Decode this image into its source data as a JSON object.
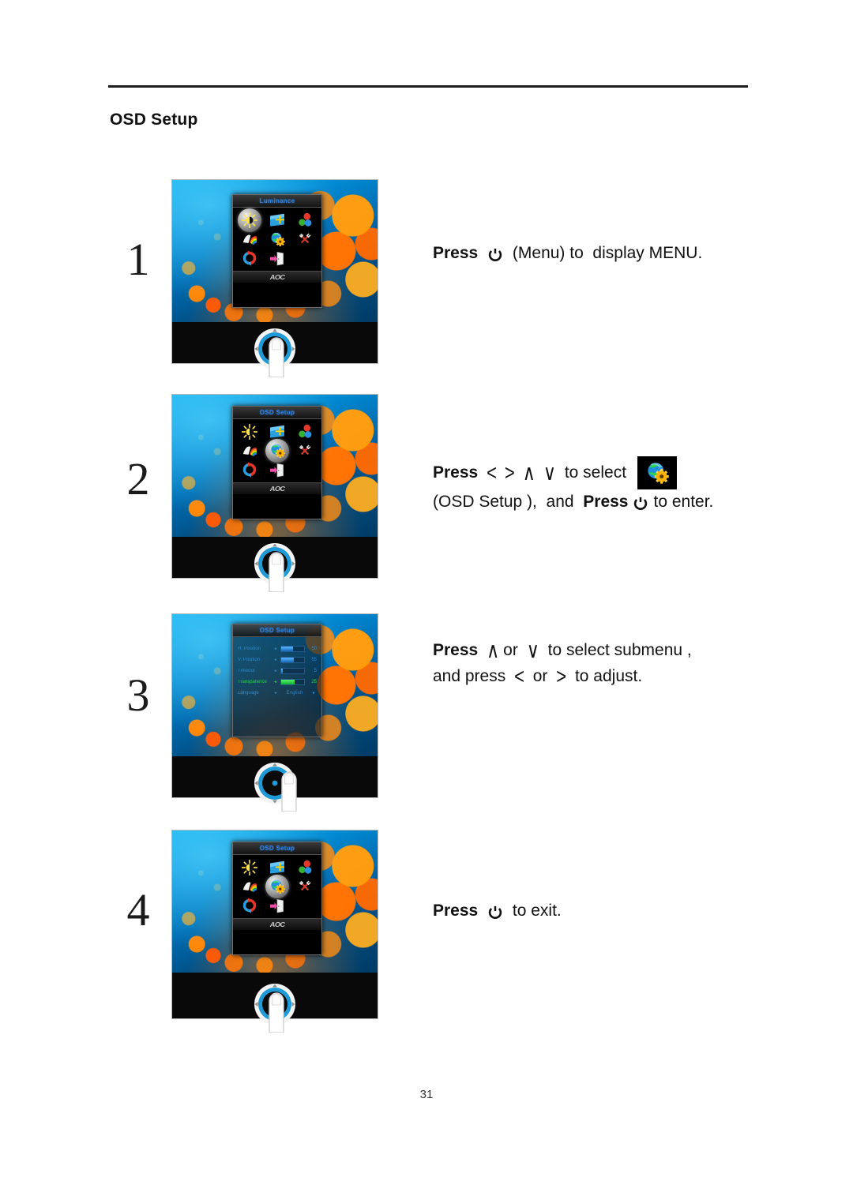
{
  "document": {
    "section_title": "OSD Setup",
    "page_number": "31"
  },
  "icons": {
    "power": "power-icon",
    "osd_setup": "osd-setup-globe-gear-icon",
    "left": "<",
    "right": ">",
    "up": "∧",
    "down": "∨"
  },
  "osd_menu": {
    "footer_logo": "AOC",
    "items": [
      "luminance-icon",
      "image-setup-icon",
      "color-temperature-icon",
      "picture-boost-icon",
      "osd-setup-icon",
      "extra-icon",
      "reset-icon",
      "exit-icon"
    ]
  },
  "steps": [
    {
      "number": "1",
      "osd_title": "Luminance",
      "selected_icon": "luminance-icon",
      "text_lines": [
        [
          {
            "t": "text",
            "v": "Press ",
            "bold": true
          },
          {
            "t": "power"
          },
          {
            "t": "text",
            "v": " (Menu) to  display MENU.",
            "bold": false
          }
        ]
      ]
    },
    {
      "number": "2",
      "osd_title": "OSD Setup",
      "selected_icon": "osd-setup-icon",
      "text_lines": [
        [
          {
            "t": "text",
            "v": "Press ",
            "bold": true
          },
          {
            "t": "chev",
            "v": "<"
          },
          {
            "t": "chev",
            "v": ">"
          },
          {
            "t": "chev",
            "v": "∧"
          },
          {
            "t": "chev",
            "v": "∨"
          },
          {
            "t": "text",
            "v": " to select ",
            "bold": false
          },
          {
            "t": "icon"
          }
        ],
        [
          {
            "t": "text",
            "v": "(OSD Setup ),  and  ",
            "bold": false
          },
          {
            "t": "text",
            "v": "Press",
            "bold": true
          },
          {
            "t": "power"
          },
          {
            "t": "text",
            "v": "to enter.",
            "bold": false
          }
        ]
      ]
    },
    {
      "number": "3",
      "osd_title": "OSD Setup",
      "submenu": {
        "rows": [
          {
            "label": "H. Position",
            "value": "50",
            "fill": 50,
            "type": "bar",
            "active": false
          },
          {
            "label": "V. Position",
            "value": "55",
            "fill": 55,
            "type": "bar",
            "active": false
          },
          {
            "label": "Timeout",
            "value": "5",
            "fill": 8,
            "type": "bar",
            "active": false
          },
          {
            "label": "Transparence",
            "value": "25",
            "fill": 60,
            "type": "bar",
            "active": true
          },
          {
            "label": "Language",
            "value": "English",
            "type": "choice",
            "active": false
          }
        ]
      },
      "text_lines": [
        [
          {
            "t": "text",
            "v": "Press ",
            "bold": true
          },
          {
            "t": "chev",
            "v": "∧"
          },
          {
            "t": "text",
            "v": "or ",
            "bold": false
          },
          {
            "t": "chev",
            "v": "∨"
          },
          {
            "t": "text",
            "v": " to select submenu ,",
            "bold": false
          }
        ],
        [
          {
            "t": "text",
            "v": "and press ",
            "bold": false
          },
          {
            "t": "chev",
            "v": "<"
          },
          {
            "t": "text",
            "v": " or ",
            "bold": false
          },
          {
            "t": "chev",
            "v": ">"
          },
          {
            "t": "text",
            "v": " to adjust.",
            "bold": false
          }
        ]
      ]
    },
    {
      "number": "4",
      "osd_title": "OSD Setup",
      "selected_icon": "osd-setup-icon",
      "text_lines": [
        [
          {
            "t": "text",
            "v": "Press ",
            "bold": true
          },
          {
            "t": "power"
          },
          {
            "t": "text",
            "v": " to exit.",
            "bold": false
          }
        ]
      ]
    }
  ],
  "colors": {
    "osd_title_blue": "#2f7fd6",
    "osd_active_green": "#25d646",
    "knob_blue": "#1f9ad6",
    "rule": "#1d1d1d"
  }
}
